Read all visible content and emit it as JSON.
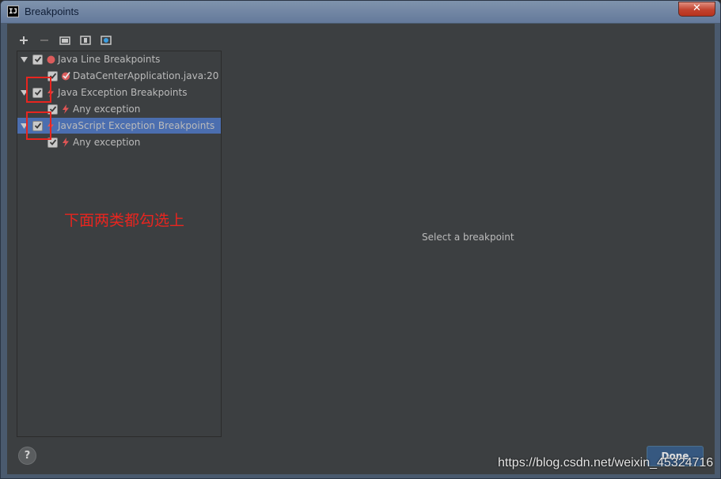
{
  "window": {
    "title": "Breakpoints",
    "app_icon_text": "IJ",
    "close_glyph": "✕"
  },
  "toolbar": {
    "buttons": [
      {
        "name": "add-icon",
        "glyph": "+"
      },
      {
        "name": "remove-icon",
        "glyph": "−"
      },
      {
        "name": "group-by-package-icon"
      },
      {
        "name": "group-by-file-icon"
      },
      {
        "name": "group-by-class-icon"
      }
    ]
  },
  "tree": {
    "items": [
      {
        "label": "Java Line Breakpoints",
        "level": 0,
        "checked": true,
        "icon": "red-circle-icon"
      },
      {
        "label": "DataCenterApplication.java:20",
        "level": 1,
        "checked": true,
        "icon": "breakpoint-check-icon"
      },
      {
        "label": "Java Exception Breakpoints",
        "level": 0,
        "checked": true,
        "icon": "lightning-icon"
      },
      {
        "label": "Any exception",
        "level": 1,
        "checked": true,
        "icon": "lightning-icon"
      },
      {
        "label": "JavaScript Exception Breakpoints",
        "level": 0,
        "checked": true,
        "icon": "lightning-icon",
        "selected": true
      },
      {
        "label": "Any exception",
        "level": 1,
        "checked": true,
        "icon": "lightning-icon"
      }
    ]
  },
  "detail": {
    "placeholder": "Select a breakpoint"
  },
  "annotation": {
    "text": "下面两类都勾选上"
  },
  "footer": {
    "help_label": "?",
    "done_label": "Done"
  },
  "watermark": "https://blog.csdn.net/weixin_45324716",
  "colors": {
    "background": "#3c3f41",
    "selection": "#4b6eaf",
    "annotation": "#e8251f",
    "breakpoint_red": "#db5c5c",
    "done_button": "#365880"
  }
}
